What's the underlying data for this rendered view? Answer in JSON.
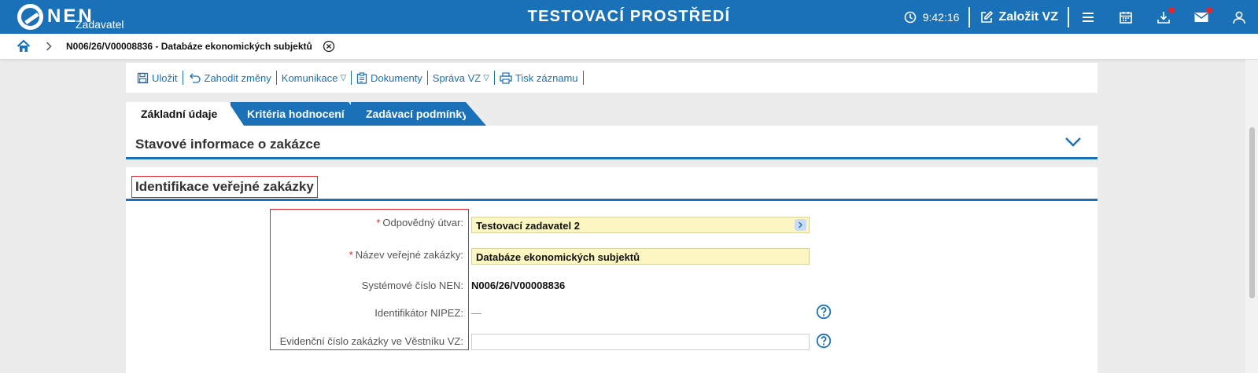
{
  "header": {
    "logo_text": "NEN",
    "logo_sub": "Zadavatel",
    "env_title": "TESTOVACÍ PROSTŘEDÍ",
    "clock": "9:42:16",
    "create_label": "Založit VZ",
    "icons": [
      "clock-icon",
      "edit-icon",
      "menu-icon",
      "calendar-icon",
      "download-icon",
      "mail-icon",
      "user-icon"
    ],
    "notification_color": "#e1262d",
    "brand_color": "#1b71b8"
  },
  "breadcrumb": {
    "text": "N006/26/V00008836 - Databáze ekonomických subjektů"
  },
  "toolbar": {
    "save": "Uložit",
    "discard": "Zahodit změny",
    "communication": "Komunikace",
    "documents": "Dokumenty",
    "management": "Správa VZ",
    "print": "Tisk záznamu"
  },
  "tabs": [
    {
      "label": "Základní údaje",
      "active": true
    },
    {
      "label": "Kritéria hodnocení",
      "active": false
    },
    {
      "label": "Zadávací podmínky",
      "active": false
    }
  ],
  "sections": {
    "status_title": "Stavové informace o zakázce",
    "identification_title": "Identifikace veřejné zakázky"
  },
  "form": {
    "required_mark": "*",
    "unit_label": "Odpovědný útvar:",
    "unit_value": "Testovací zadavatel 2",
    "name_label": "Název veřejné zakázky:",
    "name_value": "Databáze ekonomických subjektů",
    "system_label": "Systémové číslo NEN:",
    "system_value": "N006/26/V00008836",
    "nipez_label": "Identifikátor NIPEZ:",
    "nipez_value": "—",
    "journal_label": "Evidenční číslo zakázky ve Věstníku VZ:",
    "journal_value": ""
  }
}
